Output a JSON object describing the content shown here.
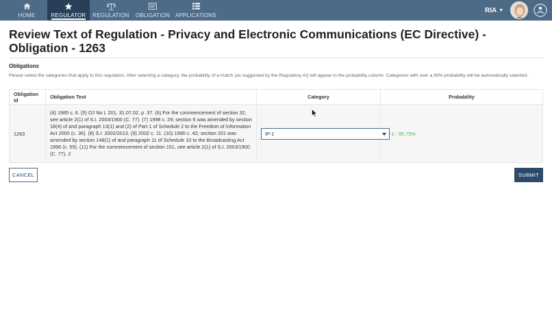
{
  "nav": {
    "items": [
      {
        "label": "HOME",
        "icon": "home-icon"
      },
      {
        "label": "REGULATOR",
        "icon": "star-icon",
        "active": true
      },
      {
        "label": "REGULATION",
        "icon": "scales-icon"
      },
      {
        "label": "OBLIGATION",
        "icon": "document-icon"
      },
      {
        "label": "APPLICATIONS",
        "icon": "grid-list-icon"
      }
    ],
    "user": "RIA"
  },
  "page": {
    "title": "Review Text of Regulation - Privacy and Electronic Communications (EC Directive) - Obligation - 1263",
    "section": "Obligations",
    "help": "Please select the categories that apply to this regulation. After selecting a category, the probability of a match (as suggested by the Regulatory AI) will appear in the probability column. Categories with over a 90% probability will be automatically selected."
  },
  "table": {
    "headers": [
      "Obligation Id",
      "Obligation Text",
      "Category",
      "Probability"
    ],
    "rows": [
      {
        "id": "1263",
        "text": "(4) 1985 c. 6. (5) OJ No L 201, 31.07.02, p. 37. (6) For the commencement of section 32, see article 2(1) of S.I. 2003/1900 (C. 77). (7) 1998 c. 29; section 6 was amended by section 18(4) of and paragraph 13(1) and (2) of Part 1 of Schedule 2 to the Freedom of Information Act 2000 (c. 36). (8) S.I. 2002/2013. (9) 2002 c. 11. (10) 1990 c. 42; section 201 was amended by section 148(1) of and paragraph 11 of Schedule 10 to the Broadcasting Act 1996 (c. 55). (11) For the commencement of section 151, see article 2(1) of S.I. 2003/1900 (C. 77). 2",
        "category": "IP-1",
        "probability": "IP-1 - 95.75%"
      }
    ]
  },
  "actions": {
    "cancel": "CANCEL",
    "submit": "SUBMIT"
  },
  "colors": {
    "navbar": "#4d6a87",
    "nav_active": "#273f58",
    "primary_button": "#2d4a68",
    "probability": "#4caf50"
  }
}
